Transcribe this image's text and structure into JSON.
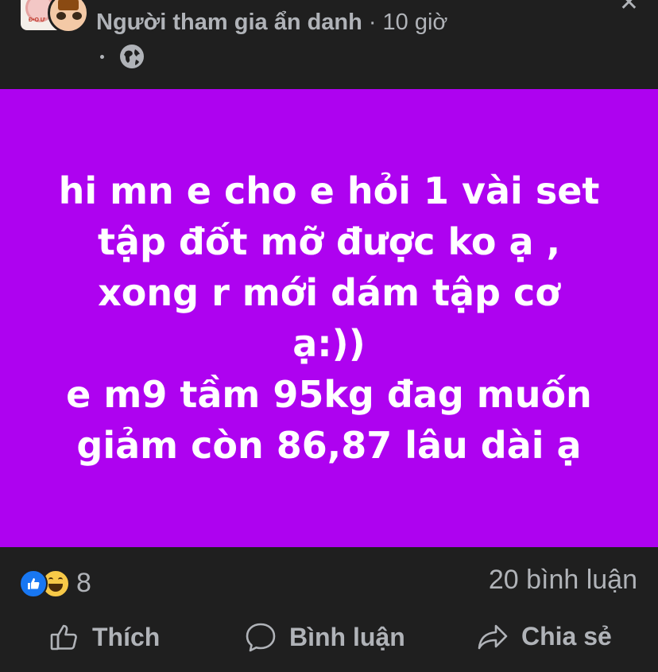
{
  "header": {
    "group_name_partial": "",
    "author": "Người tham gia ẩn danh",
    "separator": "·",
    "time": "10 giờ",
    "group_thumb_text": "Đ•O Ư"
  },
  "post": {
    "text": "hi mn e cho e hỏi 1 vài set\ntập đốt mỡ được ko ạ ,\nxong r mới dám tập cơ\nạ:))\ne m9 tầm 95kg đag muốn\ngiảm còn 86,87 lâu dài ạ",
    "background_color": "#ae02f0"
  },
  "stats": {
    "reaction_count": "8",
    "comment_count": "20 bình luận"
  },
  "actions": {
    "like_label": "Thích",
    "comment_label": "Bình luận",
    "share_label": "Chia sẻ"
  },
  "icons": {
    "privacy": "globe-icon",
    "like": "thumbs-up-icon",
    "comment": "speech-bubble-icon",
    "share": "share-arrow-icon"
  }
}
